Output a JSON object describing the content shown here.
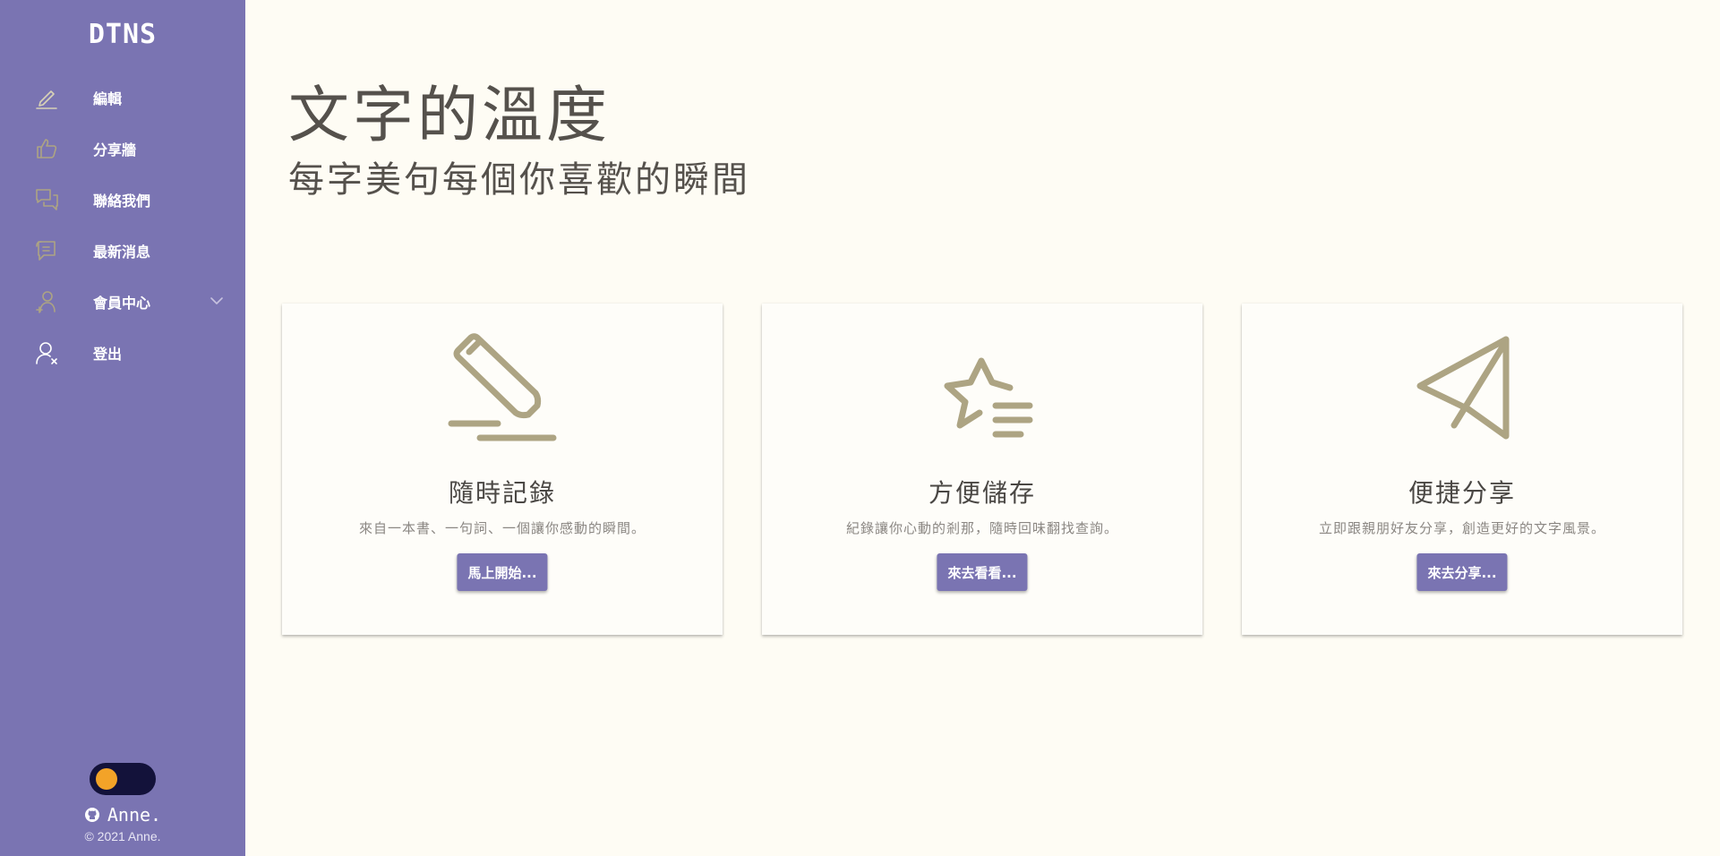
{
  "brand": "DTNS",
  "sidebar": {
    "items": [
      {
        "label": "編輯",
        "icon": "pencil-icon"
      },
      {
        "label": "分享牆",
        "icon": "thumbs-up-icon"
      },
      {
        "label": "聯絡我們",
        "icon": "chat-bubbles-icon"
      },
      {
        "label": "最新消息",
        "icon": "message-icon"
      },
      {
        "label": "會員中心",
        "icon": "add-user-icon"
      },
      {
        "label": "登出",
        "icon": "user-logout-icon"
      }
    ],
    "footer_user": "Anne.",
    "copyright": "© 2021 Anne."
  },
  "hero": {
    "title": "文字的溫度",
    "subtitle": "每字美句每個你喜歡的瞬間"
  },
  "cards": [
    {
      "icon": "pencil-icon",
      "title": "隨時記錄",
      "desc": "來自一本書、一句詞、一個讓你感動的瞬間。",
      "button": "馬上開始..."
    },
    {
      "icon": "star-list-icon",
      "title": "方便儲存",
      "desc": "紀錄讓你心動的剎那，隨時回味翻找查詢。",
      "button": "來去看看..."
    },
    {
      "icon": "send-icon",
      "title": "便捷分享",
      "desc": "立即跟親朋好友分享，創造更好的文字風景。",
      "button": "來去分享..."
    }
  ],
  "colors": {
    "sidebar": "#7a74b2",
    "background": "#fefcf4",
    "icon_tan": "#ada483",
    "toggle_track": "#13123a",
    "toggle_knob": "#f3a328"
  }
}
